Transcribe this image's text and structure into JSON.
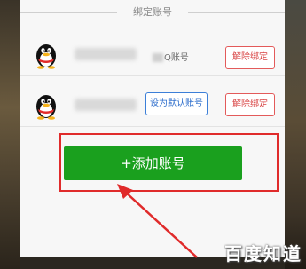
{
  "section": {
    "title": "绑定账号"
  },
  "accounts": [
    {
      "type_label": "Q账号",
      "unbind_label": "解除绑定",
      "avatar_icon": "qq-penguin-icon"
    },
    {
      "default_label": "设为默认账号",
      "unbind_label": "解除绑定",
      "avatar_icon": "qq-penguin-icon"
    }
  ],
  "add_button": {
    "label": "+添加账号"
  },
  "watermark": {
    "text": "百度知道"
  },
  "colors": {
    "add_green": "#1aa01e",
    "highlight_red": "#e02b2b",
    "unbind_red": "#d94646",
    "default_blue": "#2f6fcc"
  }
}
